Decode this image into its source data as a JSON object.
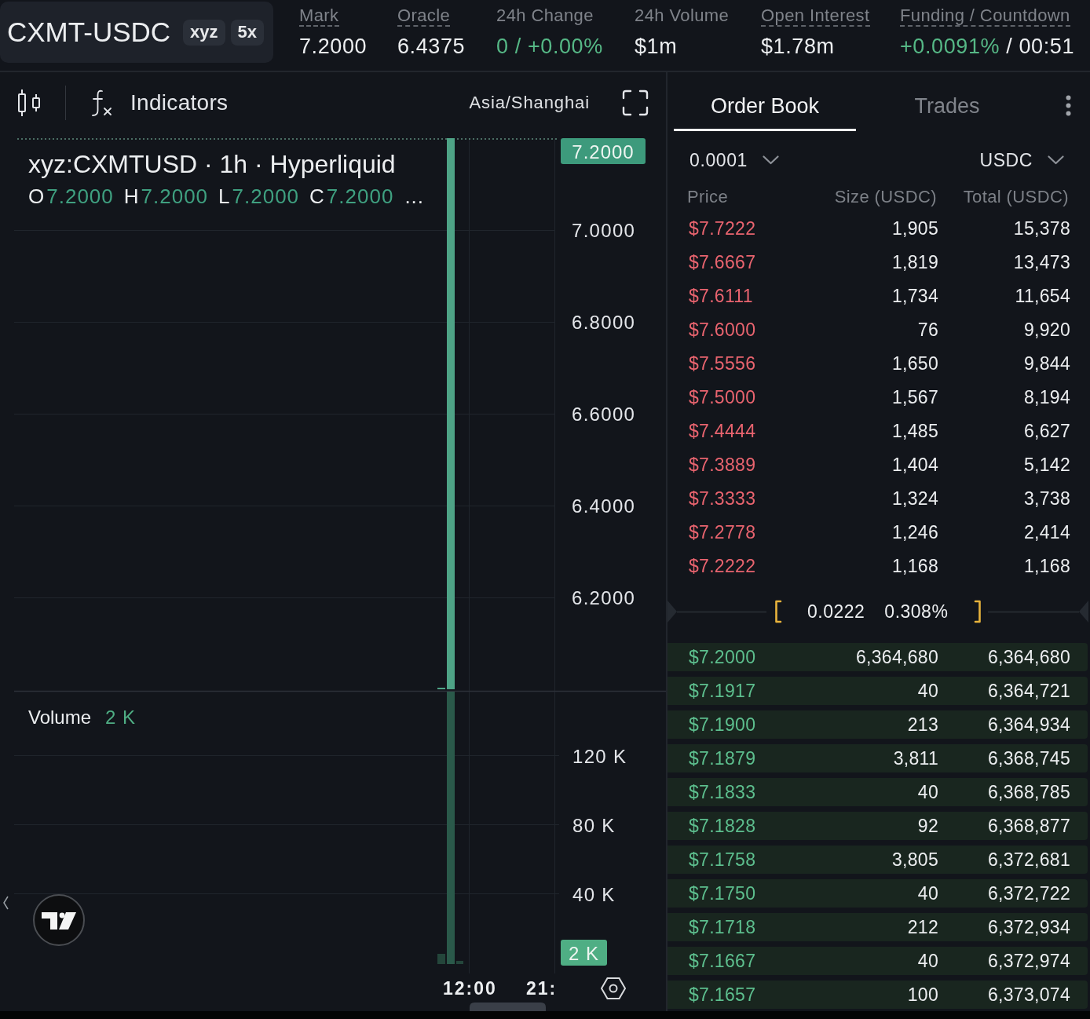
{
  "header": {
    "symbol": "CXMT-USDC",
    "badges": [
      "xyz",
      "5x"
    ],
    "stats": [
      {
        "label": "Mark",
        "underlined": true,
        "value": [
          {
            "text": "7.2000",
            "kind": "plain"
          }
        ]
      },
      {
        "label": "Oracle",
        "underlined": true,
        "value": [
          {
            "text": "6.4375",
            "kind": "plain"
          }
        ]
      },
      {
        "label": "24h Change",
        "underlined": false,
        "value": [
          {
            "text": "0 / +0.00%",
            "kind": "positive"
          }
        ]
      },
      {
        "label": "24h Volume",
        "underlined": false,
        "value": [
          {
            "text": "$1m",
            "kind": "plain"
          }
        ]
      },
      {
        "label": "Open Interest",
        "underlined": true,
        "value": [
          {
            "text": "$1.78m",
            "kind": "plain"
          }
        ]
      },
      {
        "label": "Funding / Countdown",
        "underlined": true,
        "value": [
          {
            "text": "+0.0091%",
            "kind": "positive"
          },
          {
            "text": "/ 00:51",
            "kind": "plain"
          }
        ]
      }
    ]
  },
  "chart_toolbar": {
    "indicators": "Indicators",
    "timezone": "Asia/Shanghai"
  },
  "chart": {
    "legend": {
      "title": "xyz:CXMTUSD · 1h · Hyperliquid",
      "ohlc": [
        {
          "key": "O",
          "value": "7.2000"
        },
        {
          "key": "H",
          "value": "7.2000"
        },
        {
          "key": "L",
          "value": "7.2000"
        },
        {
          "key": "C",
          "value": "7.2000"
        }
      ],
      "more": "..."
    },
    "last_price": "7.2000",
    "price_axis": [
      "7.0000",
      "6.8000",
      "6.6000",
      "6.4000",
      "6.2000"
    ],
    "volume_legend": {
      "label": "Volume",
      "value": "2 K"
    },
    "last_volume": "2 K",
    "volume_axis": [
      "120 K",
      "80 K",
      "40 K"
    ],
    "time_axis": [
      "12:00",
      "21:"
    ]
  },
  "order_book": {
    "tabs": [
      {
        "label": "Order Book",
        "selected": true
      },
      {
        "label": "Trades",
        "selected": false
      }
    ],
    "tick_size": "0.0001",
    "unit": "USDC",
    "columns": [
      "Price",
      "Size (USDC)",
      "Total (USDC)"
    ],
    "asks": [
      {
        "price": "$7.7222",
        "size": "1,905",
        "total": "15,378"
      },
      {
        "price": "$7.6667",
        "size": "1,819",
        "total": "13,473"
      },
      {
        "price": "$7.6111",
        "size": "1,734",
        "total": "11,654"
      },
      {
        "price": "$7.6000",
        "size": "76",
        "total": "9,920"
      },
      {
        "price": "$7.5556",
        "size": "1,650",
        "total": "9,844"
      },
      {
        "price": "$7.5000",
        "size": "1,567",
        "total": "8,194"
      },
      {
        "price": "$7.4444",
        "size": "1,485",
        "total": "6,627"
      },
      {
        "price": "$7.3889",
        "size": "1,404",
        "total": "5,142"
      },
      {
        "price": "$7.3333",
        "size": "1,324",
        "total": "3,738"
      },
      {
        "price": "$7.2778",
        "size": "1,246",
        "total": "2,414"
      },
      {
        "price": "$7.2222",
        "size": "1,168",
        "total": "1,168"
      }
    ],
    "spread": {
      "value": "0.0222",
      "percent": "0.308%"
    },
    "bids": [
      {
        "price": "$7.2000",
        "size": "6,364,680",
        "total": "6,364,680"
      },
      {
        "price": "$7.1917",
        "size": "40",
        "total": "6,364,721"
      },
      {
        "price": "$7.1900",
        "size": "213",
        "total": "6,364,934"
      },
      {
        "price": "$7.1879",
        "size": "3,811",
        "total": "6,368,745"
      },
      {
        "price": "$7.1833",
        "size": "40",
        "total": "6,368,785"
      },
      {
        "price": "$7.1828",
        "size": "92",
        "total": "6,368,877"
      },
      {
        "price": "$7.1758",
        "size": "3,805",
        "total": "6,372,681"
      },
      {
        "price": "$7.1750",
        "size": "40",
        "total": "6,372,722"
      },
      {
        "price": "$7.1718",
        "size": "212",
        "total": "6,372,934"
      },
      {
        "price": "$7.1667",
        "size": "40",
        "total": "6,372,974"
      },
      {
        "price": "$7.1657",
        "size": "100",
        "total": "6,373,074"
      }
    ]
  }
}
